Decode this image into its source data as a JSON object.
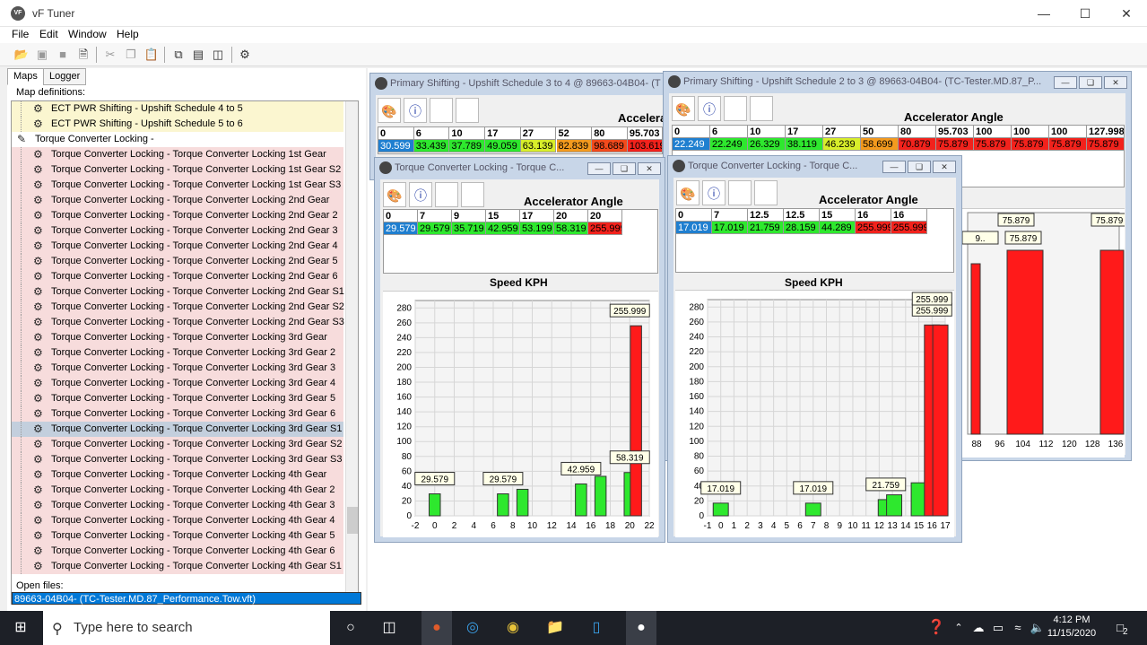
{
  "app": {
    "title": "vF Tuner",
    "logo": "VF"
  },
  "menu": [
    "File",
    "Edit",
    "Window",
    "Help"
  ],
  "tabs": [
    "Maps",
    "Logger"
  ],
  "left": {
    "map_defs_label": "Map definitions:",
    "open_files_label": "Open files:",
    "open_file": "89663-04B04- (TC-Tester.MD.87_Performance.Tow.vft)",
    "rows": [
      {
        "label": "ECT PWR Shifting - Upshift Schedule 4 to 5",
        "kind": "item",
        "color": "#fbf6d0"
      },
      {
        "label": "ECT PWR Shifting - Upshift Schedule 5 to 6",
        "kind": "item",
        "color": "#fbf6d0"
      },
      {
        "label": "Torque Converter Locking -",
        "kind": "folder",
        "color": "#ffffff"
      },
      {
        "label": "Torque Converter Locking - Torque Converter Locking 1st Gear",
        "kind": "item",
        "color": "#f7dcdc"
      },
      {
        "label": "Torque Converter Locking - Torque Converter Locking 1st Gear S2",
        "kind": "item",
        "color": "#f7dcdc"
      },
      {
        "label": "Torque Converter Locking - Torque Converter Locking 1st Gear S3",
        "kind": "item",
        "color": "#f7dcdc"
      },
      {
        "label": "Torque Converter Locking - Torque Converter Locking 2nd Gear",
        "kind": "item",
        "color": "#f7dcdc"
      },
      {
        "label": "Torque Converter Locking - Torque Converter Locking 2nd Gear 2",
        "kind": "item",
        "color": "#f7dcdc"
      },
      {
        "label": "Torque Converter Locking - Torque Converter Locking 2nd Gear 3",
        "kind": "item",
        "color": "#f7dcdc"
      },
      {
        "label": "Torque Converter Locking - Torque Converter Locking 2nd Gear 4",
        "kind": "item",
        "color": "#f7dcdc"
      },
      {
        "label": "Torque Converter Locking - Torque Converter Locking 2nd Gear 5",
        "kind": "item",
        "color": "#f7dcdc"
      },
      {
        "label": "Torque Converter Locking - Torque Converter Locking 2nd Gear 6",
        "kind": "item",
        "color": "#f7dcdc"
      },
      {
        "label": "Torque Converter Locking - Torque Converter Locking 2nd Gear S1",
        "kind": "item",
        "color": "#f7dcdc"
      },
      {
        "label": "Torque Converter Locking - Torque Converter Locking 2nd Gear S2",
        "kind": "item",
        "color": "#f7dcdc"
      },
      {
        "label": "Torque Converter Locking - Torque Converter Locking 2nd Gear S3",
        "kind": "item",
        "color": "#f7dcdc"
      },
      {
        "label": "Torque Converter Locking - Torque Converter Locking 3rd Gear",
        "kind": "item",
        "color": "#f7dcdc"
      },
      {
        "label": "Torque Converter Locking - Torque Converter Locking 3rd Gear 2",
        "kind": "item",
        "color": "#f7dcdc"
      },
      {
        "label": "Torque Converter Locking - Torque Converter Locking 3rd Gear 3",
        "kind": "item",
        "color": "#f7dcdc"
      },
      {
        "label": "Torque Converter Locking - Torque Converter Locking 3rd Gear 4",
        "kind": "item",
        "color": "#f7dcdc"
      },
      {
        "label": "Torque Converter Locking - Torque Converter Locking 3rd Gear 5",
        "kind": "item",
        "color": "#f7dcdc"
      },
      {
        "label": "Torque Converter Locking - Torque Converter Locking 3rd Gear 6",
        "kind": "item",
        "color": "#f7dcdc"
      },
      {
        "label": "Torque Converter Locking - Torque Converter Locking 3rd Gear S1",
        "kind": "item",
        "color": "#c3cfdd"
      },
      {
        "label": "Torque Converter Locking - Torque Converter Locking 3rd Gear S2",
        "kind": "item",
        "color": "#f7dcdc"
      },
      {
        "label": "Torque Converter Locking - Torque Converter Locking 3rd Gear S3",
        "kind": "item",
        "color": "#f7dcdc"
      },
      {
        "label": "Torque Converter Locking - Torque Converter Locking 4th Gear",
        "kind": "item",
        "color": "#f7dcdc"
      },
      {
        "label": "Torque Converter Locking - Torque Converter Locking 4th Gear 2",
        "kind": "item",
        "color": "#f7dcdc"
      },
      {
        "label": "Torque Converter Locking - Torque Converter Locking 4th Gear 3",
        "kind": "item",
        "color": "#f7dcdc"
      },
      {
        "label": "Torque Converter Locking - Torque Converter Locking 4th Gear 4",
        "kind": "item",
        "color": "#f7dcdc"
      },
      {
        "label": "Torque Converter Locking - Torque Converter Locking 4th Gear 5",
        "kind": "item",
        "color": "#f7dcdc"
      },
      {
        "label": "Torque Converter Locking - Torque Converter Locking 4th Gear 6",
        "kind": "item",
        "color": "#f7dcdc"
      },
      {
        "label": "Torque Converter Locking - Torque Converter Locking 4th Gear S1",
        "kind": "item",
        "color": "#f7dcdc"
      }
    ]
  },
  "windows": {
    "w1": {
      "title": "Primary Shifting - Upshift Schedule 3 to 4 @ 89663-04B04- (T",
      "header": "Accelerat",
      "cells": [
        {
          "h": "0",
          "v": "30.599",
          "c": "#1f7fd0",
          "tc": "#ffffff"
        },
        {
          "h": "6",
          "v": "33.439",
          "c": "#2ee82e",
          "tc": "#000000"
        },
        {
          "h": "10",
          "v": "37.789",
          "c": "#2ee82e",
          "tc": "#000000"
        },
        {
          "h": "17",
          "v": "49.059",
          "c": "#2ee82e",
          "tc": "#000000"
        },
        {
          "h": "27",
          "v": "63.139",
          "c": "#d8ee2a",
          "tc": "#000000"
        },
        {
          "h": "52",
          "v": "82.839",
          "c": "#f39a1e",
          "tc": "#000000"
        },
        {
          "h": "80",
          "v": "98.689",
          "c": "#f24a1c",
          "tc": "#000000"
        },
        {
          "h": "95.703",
          "v": "103.619",
          "c": "#f2221c",
          "tc": "#000000"
        }
      ]
    },
    "w2": {
      "title": "Primary Shifting - Upshift Schedule 2 to 3 @ 89663-04B04- (TC-Tester.MD.87_P...",
      "header": "Accelerator Angle",
      "cells": [
        {
          "h": "0",
          "v": "22.249",
          "c": "#1f7fd0",
          "tc": "#ffffff"
        },
        {
          "h": "6",
          "v": "22.249",
          "c": "#2ee82e",
          "tc": "#000000"
        },
        {
          "h": "10",
          "v": "26.329",
          "c": "#2ee82e",
          "tc": "#000000"
        },
        {
          "h": "17",
          "v": "38.119",
          "c": "#2ee82e",
          "tc": "#000000"
        },
        {
          "h": "27",
          "v": "46.239",
          "c": "#d8ee2a",
          "tc": "#000000"
        },
        {
          "h": "50",
          "v": "58.699",
          "c": "#f39a1e",
          "tc": "#000000"
        },
        {
          "h": "80",
          "v": "70.879",
          "c": "#f2221c",
          "tc": "#000000"
        },
        {
          "h": "95.703",
          "v": "75.879",
          "c": "#f2221c",
          "tc": "#000000"
        },
        {
          "h": "100",
          "v": "75.879",
          "c": "#f2221c",
          "tc": "#000000"
        },
        {
          "h": "100",
          "v": "75.879",
          "c": "#f2221c",
          "tc": "#000000"
        },
        {
          "h": "100",
          "v": "75.879",
          "c": "#f2221c",
          "tc": "#000000"
        },
        {
          "h": "127.998",
          "v": "75.879",
          "c": "#f2221c",
          "tc": "#000000"
        }
      ],
      "chart_xticks": [
        "88",
        "96",
        "104",
        "112",
        "120",
        "128",
        "136"
      ],
      "chart_labels": [
        "75.879",
        "75.879",
        "75.879",
        "9.."
      ]
    },
    "w3": {
      "title": "Torque Converter Locking - Torque C...",
      "header": "Accelerator Angle",
      "cells": [
        {
          "h": "0",
          "v": "29.579",
          "c": "#1f7fd0",
          "tc": "#ffffff"
        },
        {
          "h": "7",
          "v": "29.579",
          "c": "#2ee82e",
          "tc": "#000000"
        },
        {
          "h": "9",
          "v": "35.719",
          "c": "#2ee82e",
          "tc": "#000000"
        },
        {
          "h": "15",
          "v": "42.959",
          "c": "#2ee82e",
          "tc": "#000000"
        },
        {
          "h": "17",
          "v": "53.199",
          "c": "#2ee82e",
          "tc": "#000000"
        },
        {
          "h": "20",
          "v": "58.319",
          "c": "#2ee82e",
          "tc": "#000000"
        },
        {
          "h": "20",
          "v": "255.999",
          "c": "#f2221c",
          "tc": "#000000"
        }
      ],
      "chart_title": "Speed KPH"
    },
    "w4": {
      "title": "Torque Converter Locking - Torque C...",
      "header": "Accelerator Angle",
      "cells": [
        {
          "h": "0",
          "v": "17.019",
          "c": "#1f7fd0",
          "tc": "#ffffff"
        },
        {
          "h": "7",
          "v": "17.019",
          "c": "#2ee82e",
          "tc": "#000000"
        },
        {
          "h": "12.5",
          "v": "21.759",
          "c": "#2ee82e",
          "tc": "#000000"
        },
        {
          "h": "12.5",
          "v": "28.159",
          "c": "#2ee82e",
          "tc": "#000000"
        },
        {
          "h": "15",
          "v": "44.289",
          "c": "#2ee82e",
          "tc": "#000000"
        },
        {
          "h": "16",
          "v": "255.999",
          "c": "#f2221c",
          "tc": "#000000"
        },
        {
          "h": "16",
          "v": "255.999",
          "c": "#f2221c",
          "tc": "#000000"
        }
      ],
      "chart_title": "Speed KPH"
    }
  },
  "chart_data": [
    {
      "type": "bar",
      "title": "Speed KPH",
      "x": [
        0,
        7,
        9,
        15,
        17,
        20,
        20
      ],
      "values": [
        29.579,
        29.579,
        35.719,
        42.959,
        53.199,
        58.319,
        255.999
      ],
      "bar_colors": [
        "#2ee82e",
        "#2ee82e",
        "#2ee82e",
        "#2ee82e",
        "#2ee82e",
        "#2ee82e",
        "#ff1a1a"
      ],
      "xlim": [
        -2,
        22
      ],
      "ylim": [
        0,
        290
      ],
      "xticks": [
        -2,
        0,
        2,
        4,
        6,
        8,
        10,
        12,
        14,
        16,
        18,
        20,
        22
      ],
      "yticks": [
        0,
        20,
        40,
        60,
        80,
        100,
        120,
        140,
        160,
        180,
        200,
        220,
        240,
        260,
        280
      ],
      "labels": [
        {
          "text": "29.579",
          "x": 0,
          "y": 29.579
        },
        {
          "text": "29.579",
          "x": 7,
          "y": 29.579
        },
        {
          "text": "42.959",
          "x": 15,
          "y": 42.959
        },
        {
          "text": "58.319",
          "x": 20,
          "y": 58.319
        },
        {
          "text": "255.999",
          "x": 20,
          "y": 255.999
        }
      ],
      "grid": true
    },
    {
      "type": "bar",
      "title": "Speed KPH",
      "x": [
        0,
        7,
        12.5,
        12.5,
        15,
        16,
        16
      ],
      "values": [
        17.019,
        17.019,
        21.759,
        28.159,
        44.289,
        255.999,
        255.999
      ],
      "bar_colors": [
        "#2ee82e",
        "#2ee82e",
        "#2ee82e",
        "#2ee82e",
        "#2ee82e",
        "#ff1a1a",
        "#ff1a1a"
      ],
      "xlim": [
        -1,
        17
      ],
      "ylim": [
        0,
        290
      ],
      "xticks": [
        -1,
        0,
        1,
        2,
        3,
        4,
        5,
        6,
        7,
        8,
        9,
        10,
        11,
        12,
        13,
        14,
        15,
        16,
        17
      ],
      "yticks": [
        0,
        20,
        40,
        60,
        80,
        100,
        120,
        140,
        160,
        180,
        200,
        220,
        240,
        260,
        280
      ],
      "labels": [
        {
          "text": "17.019",
          "x": 0,
          "y": 17.019
        },
        {
          "text": "17.019",
          "x": 7,
          "y": 17.019
        },
        {
          "text": "21.759",
          "x": 12.5,
          "y": 21.759
        },
        {
          "text": "255.999",
          "x": 16,
          "y": 255.999
        },
        {
          "text": "255.999",
          "x": 16,
          "y": 255.999
        }
      ],
      "grid": true
    }
  ],
  "taskbar": {
    "search_placeholder": "Type here to search",
    "time": "4:12 PM",
    "date": "11/15/2020",
    "notif_count": "2"
  }
}
